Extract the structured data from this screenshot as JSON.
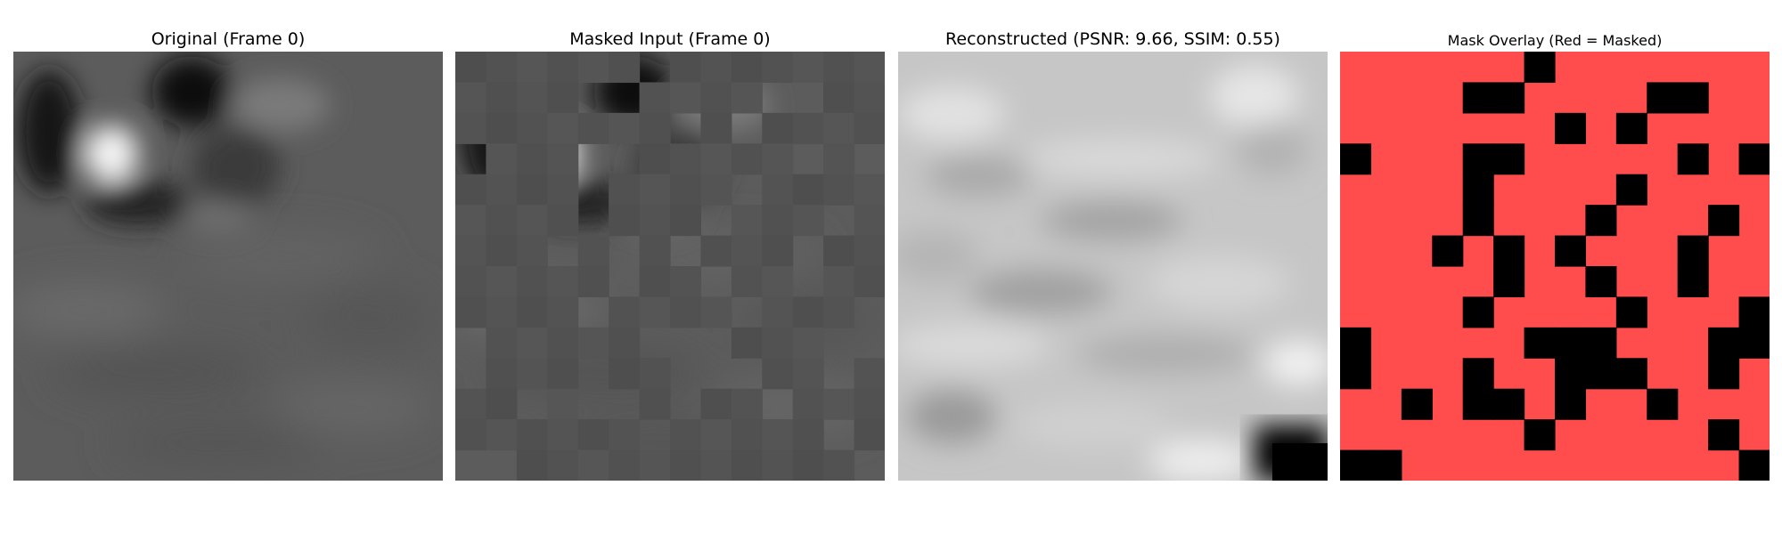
{
  "figure": {
    "panels": [
      {
        "id": "original",
        "title": "Original (Frame 0)"
      },
      {
        "id": "masked",
        "title": "Masked Input (Frame 0)"
      },
      {
        "id": "reconstructed",
        "title": "Reconstructed (PSNR: 9.66, SSIM: 0.55)"
      },
      {
        "id": "overlay",
        "title": "Mask Overlay (Red = Masked)"
      }
    ]
  },
  "colors": {
    "mask_red": "#ff4c4c",
    "visible_black": "#000000",
    "base_gray": "#5c5c5c",
    "recon_gray": "#c6c6c6"
  },
  "mask": {
    "grid_size": 14,
    "visible_cells": [
      [
        0,
        6
      ],
      [
        1,
        4
      ],
      [
        1,
        5
      ],
      [
        1,
        10
      ],
      [
        1,
        11
      ],
      [
        2,
        7
      ],
      [
        2,
        9
      ],
      [
        3,
        0
      ],
      [
        3,
        4
      ],
      [
        3,
        5
      ],
      [
        3,
        11
      ],
      [
        3,
        13
      ],
      [
        4,
        4
      ],
      [
        4,
        9
      ],
      [
        5,
        4
      ],
      [
        5,
        8
      ],
      [
        5,
        12
      ],
      [
        6,
        3
      ],
      [
        6,
        5
      ],
      [
        6,
        7
      ],
      [
        6,
        11
      ],
      [
        7,
        5
      ],
      [
        7,
        8
      ],
      [
        7,
        11
      ],
      [
        8,
        4
      ],
      [
        8,
        9
      ],
      [
        8,
        13
      ],
      [
        9,
        0
      ],
      [
        9,
        6
      ],
      [
        9,
        7
      ],
      [
        9,
        8
      ],
      [
        9,
        12
      ],
      [
        9,
        13
      ],
      [
        10,
        0
      ],
      [
        10,
        4
      ],
      [
        10,
        7
      ],
      [
        10,
        8
      ],
      [
        10,
        9
      ],
      [
        10,
        12
      ],
      [
        11,
        2
      ],
      [
        11,
        4
      ],
      [
        11,
        5
      ],
      [
        11,
        7
      ],
      [
        11,
        10
      ],
      [
        12,
        6
      ],
      [
        12,
        12
      ],
      [
        13,
        0
      ],
      [
        13,
        1
      ],
      [
        13,
        13
      ]
    ]
  }
}
